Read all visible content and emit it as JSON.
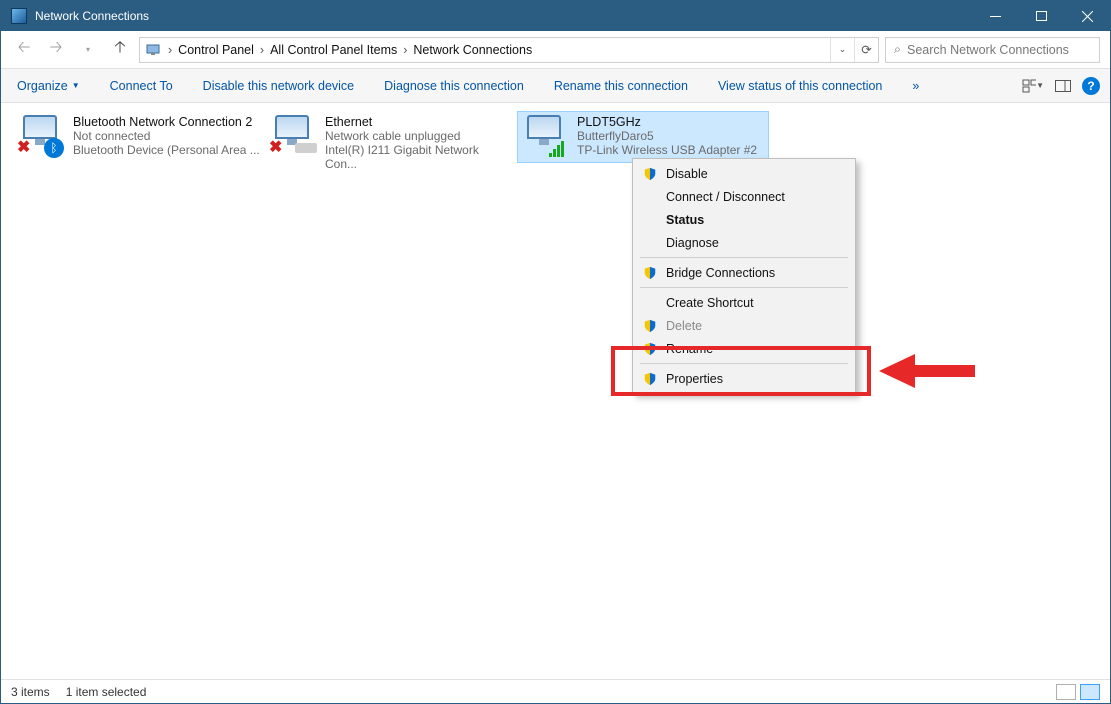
{
  "window": {
    "title": "Network Connections"
  },
  "breadcrumbs": {
    "b0": "Control Panel",
    "b1": "All Control Panel Items",
    "b2": "Network Connections"
  },
  "search": {
    "placeholder": "Search Network Connections"
  },
  "cmdbar": {
    "organize": "Organize",
    "connect_to": "Connect To",
    "disable": "Disable this network device",
    "diagnose": "Diagnose this connection",
    "rename": "Rename this connection",
    "view_status": "View status of this connection",
    "overflow": "»"
  },
  "connections": {
    "bt": {
      "name": "Bluetooth Network Connection 2",
      "status": "Not connected",
      "device": "Bluetooth Device (Personal Area ..."
    },
    "eth": {
      "name": "Ethernet",
      "status": "Network cable unplugged",
      "device": "Intel(R) I211 Gigabit Network Con..."
    },
    "wifi": {
      "name": "PLDT5GHz",
      "status": "ButterflyDaro5",
      "device": "TP-Link Wireless USB Adapter #2"
    }
  },
  "context_menu": {
    "disable": "Disable",
    "connect": "Connect / Disconnect",
    "status": "Status",
    "diagnose": "Diagnose",
    "bridge": "Bridge Connections",
    "shortcut": "Create Shortcut",
    "delete": "Delete",
    "rename": "Rename",
    "properties": "Properties"
  },
  "statusbar": {
    "count": "3 items",
    "selected": "1 item selected"
  }
}
